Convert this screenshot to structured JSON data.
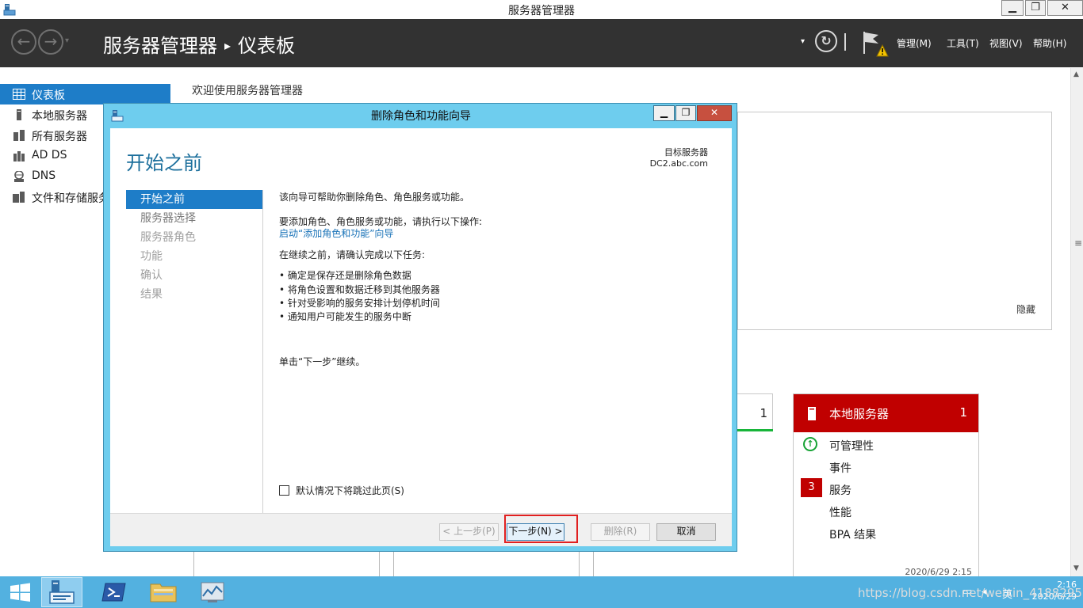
{
  "window": {
    "title": "服务器管理器",
    "min": "▁",
    "max": "❐",
    "close": "✕"
  },
  "header": {
    "crumb_root": "服务器管理器",
    "crumb_sep": "▸",
    "crumb_page": "仪表板",
    "back_glyph": "←",
    "forward_glyph": "→",
    "caret": "▾",
    "refresh_glyph": "↻",
    "menus": [
      "管理(M)",
      "工具(T)",
      "视图(V)",
      "帮助(H)"
    ]
  },
  "sidebar": {
    "items": [
      {
        "label": "仪表板",
        "icon": "dashboard-icon",
        "active": true
      },
      {
        "label": "本地服务器",
        "icon": "server-icon"
      },
      {
        "label": "所有服务器",
        "icon": "servers-icon"
      },
      {
        "label": "AD DS",
        "icon": "ad-ds-icon"
      },
      {
        "label": "DNS",
        "icon": "dns-icon"
      },
      {
        "label": "文件和存储服务",
        "icon": "file-storage-icon"
      }
    ]
  },
  "main": {
    "welcome": "欢迎使用服务器管理器",
    "hide": "隐藏",
    "partial_tile_count": "1",
    "tile": {
      "name": "本地服务器",
      "count": "1",
      "rows": [
        "可管理性",
        "事件",
        "服务",
        "性能",
        "BPA 结果"
      ],
      "services_badge": "3",
      "date": "2020/6/29 2:15"
    }
  },
  "dialog": {
    "title": "删除角色和功能向导",
    "page_title": "开始之前",
    "target_label": "目标服务器",
    "target_server": "DC2.abc.com",
    "steps": [
      "开始之前",
      "服务器选择",
      "服务器角色",
      "功能",
      "确认",
      "结果"
    ],
    "intro": "该向导可帮助你删除角色、角色服务或功能。",
    "add_hint": "要添加角色、角色服务或功能，请执行以下操作:",
    "add_link": "启动“添加角色和功能”向导",
    "confirm_hint": "在继续之前，请确认完成以下任务:",
    "tasks": [
      "确定是保存还是删除角色数据",
      "将角色设置和数据迁移到其他服务器",
      "针对受影响的服务安排计划停机时间",
      "通知用户可能发生的服务中断"
    ],
    "continue_hint": "单击“下一步”继续。",
    "skip_label": "默认情况下将跳过此页(S)",
    "buttons": {
      "prev": "< 上一步(P)",
      "next": "下一步(N) >",
      "remove": "删除(R)",
      "cancel": "取消"
    }
  },
  "taskbar": {
    "clock_time": "2:16",
    "clock_date": "2020/6/29",
    "ime": "英",
    "watermark": "https://blog.csdn.net/weixin_41882957"
  },
  "colors": {
    "header_bg": "#323232",
    "accent_blue": "#1e7dc8",
    "dialog_frame": "#6ecdee",
    "alert_red": "#c00000",
    "taskbar": "#53b1e0",
    "ok_green": "#18a336"
  }
}
